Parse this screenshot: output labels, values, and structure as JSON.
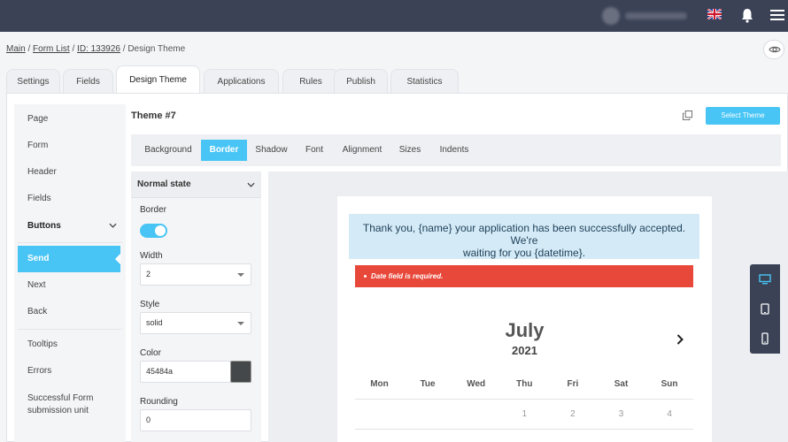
{
  "breadcrumb": {
    "main": "Main",
    "sep1": " / ",
    "form_list": "Form List",
    "sep2": " / ",
    "id": "ID: 133926",
    "sep3": " / ",
    "current": "Design Theme"
  },
  "tabs": [
    {
      "label": "Settings"
    },
    {
      "label": "Fields"
    },
    {
      "label": "Design Theme"
    },
    {
      "label": "Applications"
    },
    {
      "label": "Rules"
    },
    {
      "label": "Publish"
    },
    {
      "label": "Statistics"
    }
  ],
  "nav": {
    "items": [
      {
        "label": "Page"
      },
      {
        "label": "Form"
      },
      {
        "label": "Header"
      },
      {
        "label": "Fields"
      },
      {
        "label": "Buttons"
      },
      {
        "label": "Send"
      },
      {
        "label": "Next"
      },
      {
        "label": "Back"
      },
      {
        "label": "Tooltips"
      },
      {
        "label": "Errors"
      },
      {
        "label": "Successful Form submission unit"
      }
    ]
  },
  "theme": {
    "title": "Theme #7",
    "select_button": "Select Theme"
  },
  "subtabs": [
    {
      "label": "Background"
    },
    {
      "label": "Border"
    },
    {
      "label": "Shadow"
    },
    {
      "label": "Font"
    },
    {
      "label": "Alignment"
    },
    {
      "label": "Sizes"
    },
    {
      "label": "Indents"
    }
  ],
  "props": {
    "state": "Normal state",
    "border_label": "Border",
    "border_enabled": true,
    "width_label": "Width",
    "width_value": "2",
    "style_label": "Style",
    "style_value": "solid",
    "color_label": "Color",
    "color_value": "45484a",
    "color_hex": "#45484a",
    "rounding_label": "Rounding",
    "rounding_value": "0"
  },
  "preview": {
    "success_line1": "Thank you, {name} your application has been successfully accepted. We're",
    "success_line2": "waiting for you {datetime}.",
    "error_text": "Date field is required.",
    "month": "July",
    "year": "2021",
    "weekdays": [
      "Mon",
      "Tue",
      "Wed",
      "Thu",
      "Fri",
      "Sat",
      "Sun"
    ],
    "first_row": [
      "",
      "",
      "",
      "1",
      "2",
      "3",
      "4"
    ]
  },
  "colors": {
    "accent": "#48c5f5",
    "topbar": "#3b4256",
    "error": "#e8483a"
  },
  "icons": {
    "language": "uk-flag-icon",
    "notifications": "bell-icon",
    "menu": "hamburger-menu-icon",
    "preview_toggle": "eye-icon",
    "copy": "copy-icon",
    "desktop": "desktop-icon",
    "tablet": "tablet-icon",
    "mobile": "mobile-icon"
  }
}
